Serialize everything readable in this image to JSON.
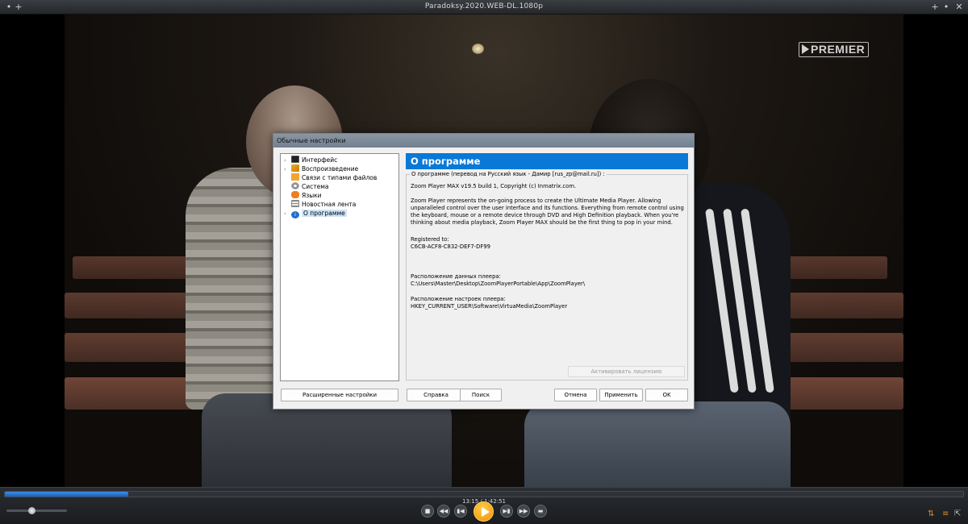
{
  "window": {
    "title": "Paradoksy.2020.WEB-DL.1080p",
    "btn_left_a": "•",
    "btn_left_b": "+",
    "btn_right_a": "+",
    "btn_right_b": "•",
    "btn_close": "✕"
  },
  "video": {
    "channel_logo": "PREMIER"
  },
  "dialog": {
    "title": "Обычные настройки",
    "tree": [
      {
        "label": "Интерфейс",
        "icon": "monitor-icon",
        "expandable": true
      },
      {
        "label": "Воспроизведение",
        "icon": "play-pencil-icon",
        "expandable": true
      },
      {
        "label": "Связи с типами файлов",
        "icon": "file-links-icon",
        "expandable": false
      },
      {
        "label": "Система",
        "icon": "gear-icon",
        "expandable": false
      },
      {
        "label": "Языки",
        "icon": "language-icon",
        "expandable": false
      },
      {
        "label": "Новостная лента",
        "icon": "news-feed-icon",
        "expandable": false
      },
      {
        "label": "О программе",
        "icon": "info-icon",
        "expandable": true,
        "selected": true
      }
    ],
    "panel": {
      "header": "О программе",
      "caption": "О программе (перевод на Русский язык - Дамир [rus_zp@mail.ru]) :",
      "version_line": "Zoom Player MAX v19.5 build 1, Copyright (c) Inmatrix.com.",
      "description": "Zoom Player represents the on-going process to create the Ultimate Media Player. Allowing unparalleled control over the user interface and its functions. Everything from remote control using the keyboard, mouse or a remote device through DVD and High Definition playback. When you're thinking about media playback, Zoom Player MAX should be the first thing to pop in your mind.",
      "registered_label": "Registered to:",
      "registered_value": "C6CB-ACF8-C832-DEF7-DF99",
      "data_location_label": "Расположение данных плеера:",
      "data_location_value": "C:\\Users\\Master\\Desktop\\ZoomPlayerPortable\\App\\ZoomPlayer\\",
      "settings_location_label": "Расположение настроек плеера:",
      "settings_location_value": "HKEY_CURRENT_USER\\Software\\VirtuaMedia\\ZoomPlayer",
      "activate_button": "Активировать лицензию"
    },
    "buttons": {
      "advanced": "Расширенные настройки",
      "help": "Справка",
      "search": "Поиск",
      "cancel": "Отмена",
      "apply": "Применить",
      "ok": "OK"
    }
  },
  "player": {
    "timecode": "13:15 / 1:42:51",
    "progress_fraction": 0.129,
    "volume_fraction": 0.42,
    "accent_color": "#f7a600"
  }
}
